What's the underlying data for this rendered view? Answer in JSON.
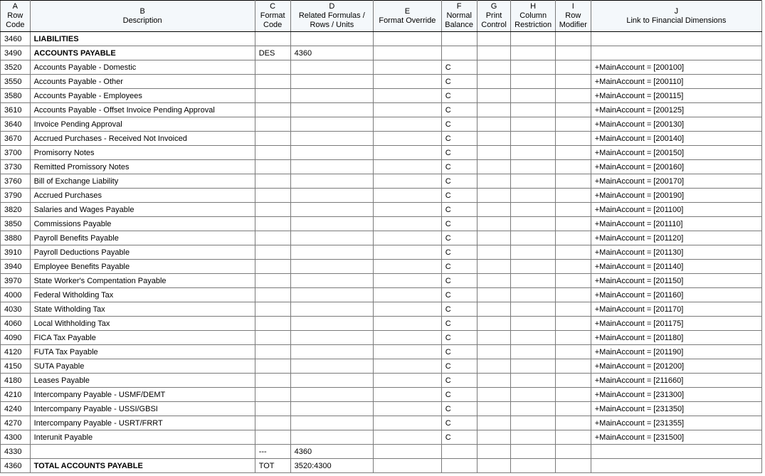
{
  "columns": [
    {
      "letter": "A",
      "label": "Row Code"
    },
    {
      "letter": "B",
      "label": "Description"
    },
    {
      "letter": "C",
      "label": "Format Code"
    },
    {
      "letter": "D",
      "label": "Related Formulas / Rows / Units"
    },
    {
      "letter": "E",
      "label": "Format Override"
    },
    {
      "letter": "F",
      "label": "Normal Balance"
    },
    {
      "letter": "G",
      "label": "Print Control"
    },
    {
      "letter": "H",
      "label": "Column Restriction"
    },
    {
      "letter": "I",
      "label": "Row Modifier"
    },
    {
      "letter": "J",
      "label": "Link to Financial Dimensions"
    }
  ],
  "rows": [
    {
      "a": "3460",
      "b": "LIABILITIES",
      "bold": true,
      "c": "",
      "d": "",
      "e": "",
      "f": "",
      "g": "",
      "h": "",
      "i": "",
      "j": ""
    },
    {
      "a": "3490",
      "b": "ACCOUNTS PAYABLE",
      "bold": true,
      "c": "DES",
      "d": "4360",
      "e": "",
      "f": "",
      "g": "",
      "h": "",
      "i": "",
      "j": ""
    },
    {
      "a": "3520",
      "b": "Accounts Payable - Domestic",
      "c": "",
      "d": "",
      "e": "",
      "f": "C",
      "g": "",
      "h": "",
      "i": "",
      "j": "+MainAccount = [200100]"
    },
    {
      "a": "3550",
      "b": "Accounts Payable - Other",
      "c": "",
      "d": "",
      "e": "",
      "f": "C",
      "g": "",
      "h": "",
      "i": "",
      "j": "+MainAccount = [200110]"
    },
    {
      "a": "3580",
      "b": "Accounts Payable - Employees",
      "c": "",
      "d": "",
      "e": "",
      "f": "C",
      "g": "",
      "h": "",
      "i": "",
      "j": "+MainAccount = [200115]"
    },
    {
      "a": "3610",
      "b": "Accounts Payable - Offset Invoice Pending Approval",
      "c": "",
      "d": "",
      "e": "",
      "f": "C",
      "g": "",
      "h": "",
      "i": "",
      "j": "+MainAccount = [200125]"
    },
    {
      "a": "3640",
      "b": "Invoice Pending Approval",
      "c": "",
      "d": "",
      "e": "",
      "f": "C",
      "g": "",
      "h": "",
      "i": "",
      "j": "+MainAccount = [200130]"
    },
    {
      "a": "3670",
      "b": "Accrued Purchases - Received Not Invoiced",
      "c": "",
      "d": "",
      "e": "",
      "f": "C",
      "g": "",
      "h": "",
      "i": "",
      "j": "+MainAccount = [200140]"
    },
    {
      "a": "3700",
      "b": "Promisorry Notes",
      "c": "",
      "d": "",
      "e": "",
      "f": "C",
      "g": "",
      "h": "",
      "i": "",
      "j": "+MainAccount = [200150]"
    },
    {
      "a": "3730",
      "b": "Remitted Promissory Notes",
      "c": "",
      "d": "",
      "e": "",
      "f": "C",
      "g": "",
      "h": "",
      "i": "",
      "j": "+MainAccount = [200160]"
    },
    {
      "a": "3760",
      "b": "Bill of Exchange Liability",
      "c": "",
      "d": "",
      "e": "",
      "f": "C",
      "g": "",
      "h": "",
      "i": "",
      "j": "+MainAccount = [200170]"
    },
    {
      "a": "3790",
      "b": "Accrued Purchases",
      "c": "",
      "d": "",
      "e": "",
      "f": "C",
      "g": "",
      "h": "",
      "i": "",
      "j": "+MainAccount = [200190]"
    },
    {
      "a": "3820",
      "b": "Salaries and Wages Payable",
      "c": "",
      "d": "",
      "e": "",
      "f": "C",
      "g": "",
      "h": "",
      "i": "",
      "j": "+MainAccount = [201100]"
    },
    {
      "a": "3850",
      "b": "Commissions Payable",
      "c": "",
      "d": "",
      "e": "",
      "f": "C",
      "g": "",
      "h": "",
      "i": "",
      "j": "+MainAccount = [201110]"
    },
    {
      "a": "3880",
      "b": "Payroll Benefits Payable",
      "c": "",
      "d": "",
      "e": "",
      "f": "C",
      "g": "",
      "h": "",
      "i": "",
      "j": "+MainAccount = [201120]"
    },
    {
      "a": "3910",
      "b": "Payroll Deductions Payable",
      "c": "",
      "d": "",
      "e": "",
      "f": "C",
      "g": "",
      "h": "",
      "i": "",
      "j": "+MainAccount = [201130]"
    },
    {
      "a": "3940",
      "b": "Employee Benefits Payable",
      "c": "",
      "d": "",
      "e": "",
      "f": "C",
      "g": "",
      "h": "",
      "i": "",
      "j": "+MainAccount = [201140]"
    },
    {
      "a": "3970",
      "b": "State Worker's Compentation Payable",
      "c": "",
      "d": "",
      "e": "",
      "f": "C",
      "g": "",
      "h": "",
      "i": "",
      "j": "+MainAccount = [201150]"
    },
    {
      "a": "4000",
      "b": "Federal Witholding Tax",
      "c": "",
      "d": "",
      "e": "",
      "f": "C",
      "g": "",
      "h": "",
      "i": "",
      "j": "+MainAccount = [201160]"
    },
    {
      "a": "4030",
      "b": "State Witholding Tax",
      "c": "",
      "d": "",
      "e": "",
      "f": "C",
      "g": "",
      "h": "",
      "i": "",
      "j": "+MainAccount = [201170]"
    },
    {
      "a": "4060",
      "b": "Local Withholding Tax",
      "c": "",
      "d": "",
      "e": "",
      "f": "C",
      "g": "",
      "h": "",
      "i": "",
      "j": "+MainAccount = [201175]"
    },
    {
      "a": "4090",
      "b": "FICA Tax Payable",
      "c": "",
      "d": "",
      "e": "",
      "f": "C",
      "g": "",
      "h": "",
      "i": "",
      "j": "+MainAccount = [201180]"
    },
    {
      "a": "4120",
      "b": "FUTA Tax Payable",
      "c": "",
      "d": "",
      "e": "",
      "f": "C",
      "g": "",
      "h": "",
      "i": "",
      "j": "+MainAccount = [201190]"
    },
    {
      "a": "4150",
      "b": "SUTA Payable",
      "c": "",
      "d": "",
      "e": "",
      "f": "C",
      "g": "",
      "h": "",
      "i": "",
      "j": "+MainAccount = [201200]"
    },
    {
      "a": "4180",
      "b": "Leases Payable",
      "c": "",
      "d": "",
      "e": "",
      "f": "C",
      "g": "",
      "h": "",
      "i": "",
      "j": "+MainAccount = [211660]"
    },
    {
      "a": "4210",
      "b": "Intercompany Payable - USMF/DEMT",
      "c": "",
      "d": "",
      "e": "",
      "f": "C",
      "g": "",
      "h": "",
      "i": "",
      "j": "+MainAccount = [231300]"
    },
    {
      "a": "4240",
      "b": "Intercompany Payable - USSI/GBSI",
      "c": "",
      "d": "",
      "e": "",
      "f": "C",
      "g": "",
      "h": "",
      "i": "",
      "j": "+MainAccount = [231350]"
    },
    {
      "a": "4270",
      "b": "Intercompany Payable - USRT/FRRT",
      "c": "",
      "d": "",
      "e": "",
      "f": "C",
      "g": "",
      "h": "",
      "i": "",
      "j": "+MainAccount = [231355]"
    },
    {
      "a": "4300",
      "b": "Interunit Payable",
      "c": "",
      "d": "",
      "e": "",
      "f": "C",
      "g": "",
      "h": "",
      "i": "",
      "j": "+MainAccount = [231500]"
    },
    {
      "a": "4330",
      "b": "",
      "c": "---",
      "d": "4360",
      "e": "",
      "f": "",
      "g": "",
      "h": "",
      "i": "",
      "j": ""
    },
    {
      "a": "4360",
      "b": "TOTAL ACCOUNTS PAYABLE",
      "bold": true,
      "c": "TOT",
      "d": "3520:4300",
      "e": "",
      "f": "",
      "g": "",
      "h": "",
      "i": "",
      "j": ""
    }
  ]
}
